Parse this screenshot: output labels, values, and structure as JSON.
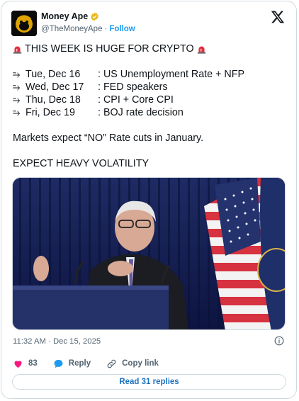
{
  "author": {
    "name": "Money Ape",
    "handle": "@TheMoneyApe",
    "separator": "·",
    "follow_label": "Follow"
  },
  "tweet": {
    "headline": "THIS WEEK IS HUGE FOR CRYPTO",
    "schedule": [
      {
        "day": "Tue, Dec 16",
        "event": "US Unemployment Rate + NFP"
      },
      {
        "day": "Wed, Dec 17",
        "event": "FED speakers"
      },
      {
        "day": "Thu, Dec 18",
        "event": "CPI + Core CPI"
      },
      {
        "day": "Fri, Dec 19",
        "event": "BOJ rate decision"
      }
    ],
    "note": "Markets expect “NO” Rate cuts in January.",
    "closing": "EXPECT HEAVY VOLATILITY"
  },
  "meta": {
    "time": "11:32 AM",
    "separator": "·",
    "date": "Dec 15, 2025"
  },
  "actions": {
    "likes": "83",
    "reply_label": "Reply",
    "copy_link_label": "Copy link"
  },
  "read_replies_label": "Read 31 replies",
  "colors": {
    "link": "#1d9bf0",
    "like": "#f91880",
    "verified": "#e8b923",
    "muted": "#536471"
  }
}
